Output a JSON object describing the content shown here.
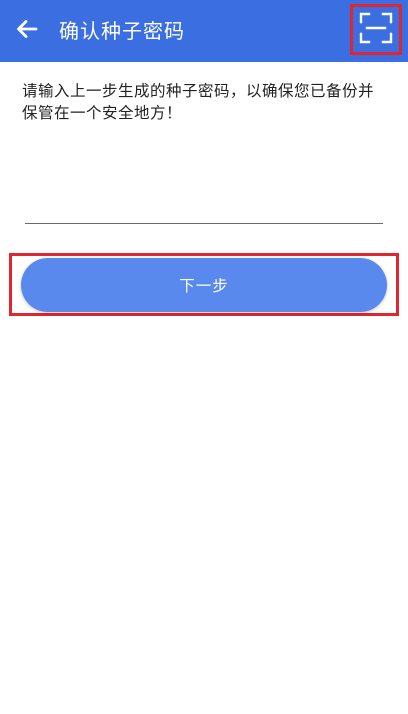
{
  "header": {
    "title": "确认种子密码",
    "back_icon": "arrow-left-icon",
    "scan_icon": "scan-frame-icon",
    "background_color": "#3b6ee0"
  },
  "main": {
    "instruction": "请输入上一步生成的种子密码，以确保您已备份并保管在一个安全地方！",
    "seed_input": {
      "value": "",
      "placeholder": ""
    },
    "next_label": "下一步",
    "next_button_color": "#5a89ee"
  },
  "highlight_color": "#e0262f"
}
